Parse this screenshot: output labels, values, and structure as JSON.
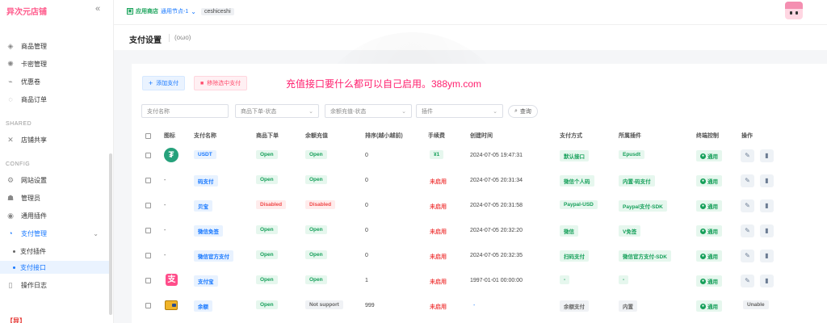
{
  "sidebar": {
    "brand": "异次元店铺",
    "items_top": [
      {
        "label": "商品管理",
        "icon": "cube-icon"
      },
      {
        "label": "卡密管理",
        "icon": "key-icon"
      },
      {
        "label": "优惠卷",
        "icon": "coupon-icon"
      },
      {
        "label": "商品订单",
        "icon": "order-icon"
      }
    ],
    "section_shared": "SHARED",
    "shared_items": [
      {
        "label": "店铺共享",
        "icon": "share-icon"
      }
    ],
    "section_config": "CONFIG",
    "config_items": [
      {
        "label": "网站设置",
        "icon": "gear-icon"
      },
      {
        "label": "管理员",
        "icon": "admin-icon"
      },
      {
        "label": "通用插件",
        "icon": "plugin-icon"
      },
      {
        "label": "支付管理",
        "icon": "pay-icon"
      }
    ],
    "pay_sub": [
      {
        "label": "支付插件"
      },
      {
        "label": "支付接口"
      }
    ],
    "log_item": {
      "label": "操作日志",
      "icon": "log-icon"
    },
    "bottom_text": "【异】"
  },
  "topbar": {
    "store": "应用商店",
    "node": "通用节点-1",
    "user": "ceshiceshi"
  },
  "page": {
    "title": "支付设置",
    "subtitle": "(oωo)"
  },
  "toolbar": {
    "add_label": "添加支付",
    "remove_label": "移除选中支付",
    "announcement": "充值接口要什么都可以自己启用。388ym.com"
  },
  "filters": {
    "name_placeholder": "支付名称",
    "order_status": "商品下单-状态",
    "recharge_status": "余额充值-状态",
    "plugin": "插件",
    "search": "查询"
  },
  "table": {
    "headers": [
      "图标",
      "支付名称",
      "商品下单",
      "余额充值",
      "排序(越小越前)",
      "手续费",
      "创建时间",
      "支付方式",
      "所属插件",
      "终端控制",
      "操作"
    ],
    "rows": [
      {
        "icon": "usdt",
        "name": "USDT",
        "order": "Open",
        "recharge": "Open",
        "sort": "0",
        "fee": "¥1",
        "created": "2024-07-05 19:47:31",
        "method": "默认接口",
        "plugin": "Epusdt",
        "terminal": "通用"
      },
      {
        "icon": "-",
        "name": "码支付",
        "order": "Open",
        "recharge": "Open",
        "sort": "0",
        "fee": "未启用",
        "created": "2024-07-05 20:31:34",
        "method": "微信个人码",
        "plugin": "内置-码支付",
        "terminal": "通用"
      },
      {
        "icon": "-",
        "name": "贝宝",
        "order": "Disabled",
        "recharge": "Disabled",
        "sort": "0",
        "fee": "未启用",
        "created": "2024-07-05 20:31:58",
        "method": "Paypal-USD",
        "plugin": "Paypal支付-SDK",
        "terminal": "通用"
      },
      {
        "icon": "-",
        "name": "微信免签",
        "order": "Open",
        "recharge": "Open",
        "sort": "0",
        "fee": "未启用",
        "created": "2024-07-05 20:32:20",
        "method": "微信",
        "plugin": "V免签",
        "terminal": "通用"
      },
      {
        "icon": "-",
        "name": "微信官方支付",
        "order": "Open",
        "recharge": "Open",
        "sort": "0",
        "fee": "未启用",
        "created": "2024-07-05 20:32:35",
        "method": "扫码支付",
        "plugin": "微信官方支付-SDK",
        "terminal": "通用"
      },
      {
        "icon": "alipay",
        "name": "支付宝",
        "order": "Open",
        "recharge": "Open",
        "sort": "1",
        "fee": "未启用",
        "created": "1997-01-01 00:00:00",
        "method": "-",
        "plugin": "-",
        "terminal": "通用"
      },
      {
        "icon": "wallet",
        "name": "余额",
        "order": "Open",
        "recharge": "Not support",
        "sort": "999",
        "fee": "未启用",
        "created": "-",
        "method": "余额支付",
        "plugin": "内置",
        "terminal": "通用",
        "action": "Unable"
      }
    ]
  }
}
